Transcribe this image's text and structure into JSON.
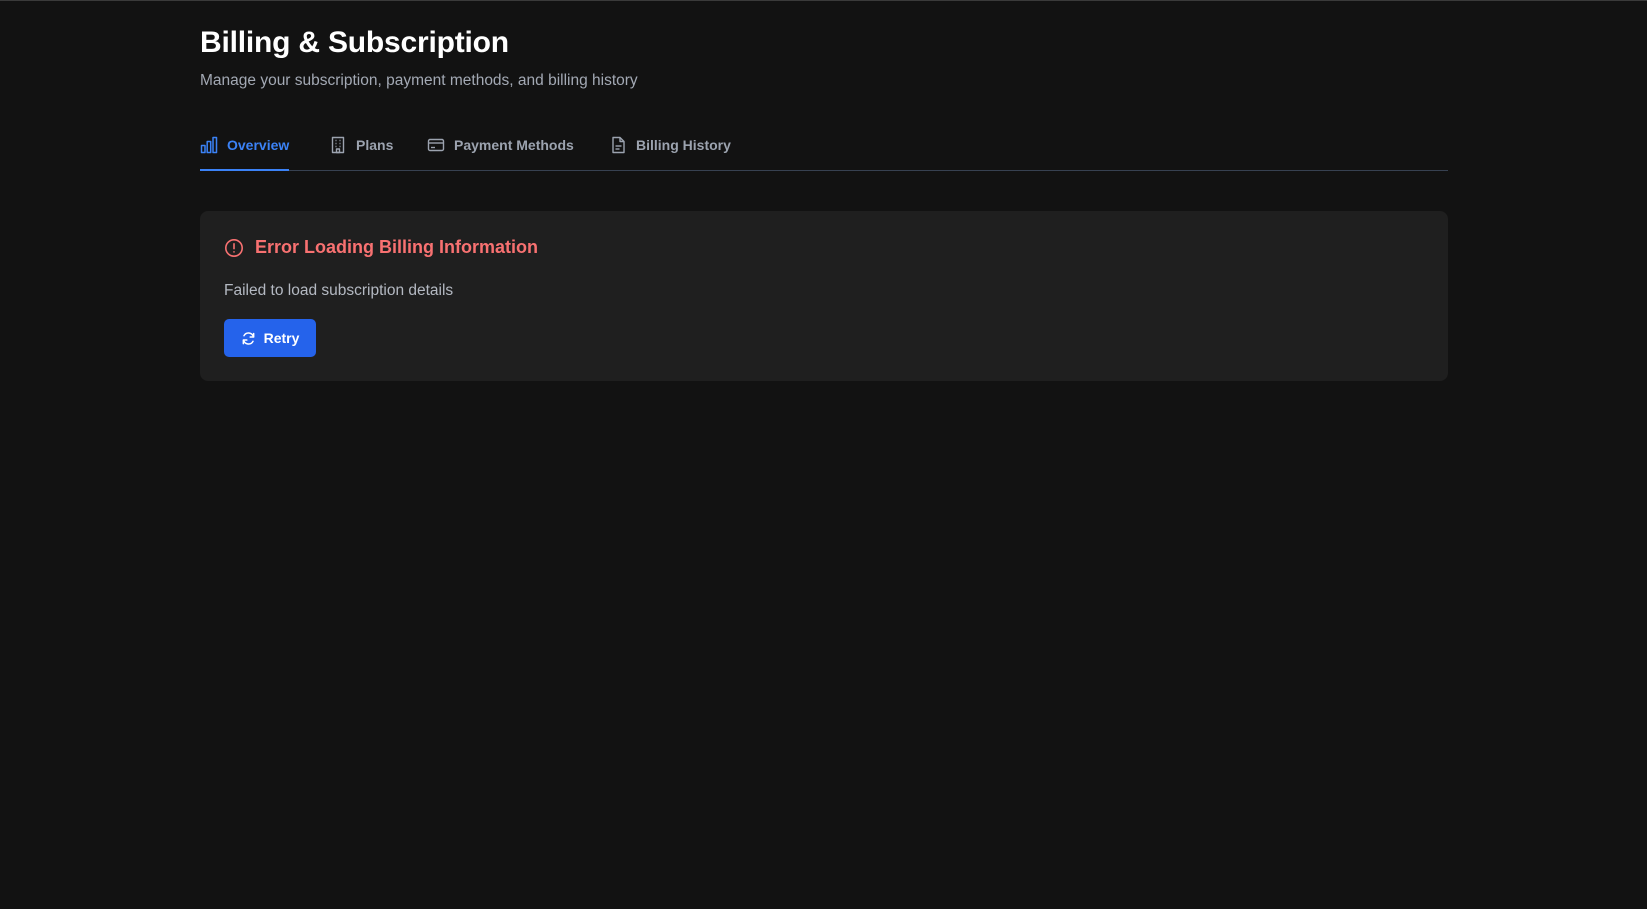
{
  "header": {
    "title": "Billing & Subscription",
    "subtitle": "Manage your subscription, payment methods, and billing history"
  },
  "tabs": [
    {
      "label": "Overview",
      "icon": "bar-chart-icon",
      "active": true
    },
    {
      "label": "Plans",
      "icon": "building-icon",
      "active": false
    },
    {
      "label": "Payment Methods",
      "icon": "credit-card-icon",
      "active": false
    },
    {
      "label": "Billing History",
      "icon": "file-text-icon",
      "active": false
    }
  ],
  "error": {
    "title": "Error Loading Billing Information",
    "message": "Failed to load subscription details",
    "icon": "alert-circle-icon",
    "retry_label": "Retry",
    "retry_icon": "refresh-icon"
  },
  "colors": {
    "background": "#121212",
    "card": "#1f1f1f",
    "accent": "#3b82f6",
    "button": "#2563eb",
    "error": "#f87171"
  }
}
